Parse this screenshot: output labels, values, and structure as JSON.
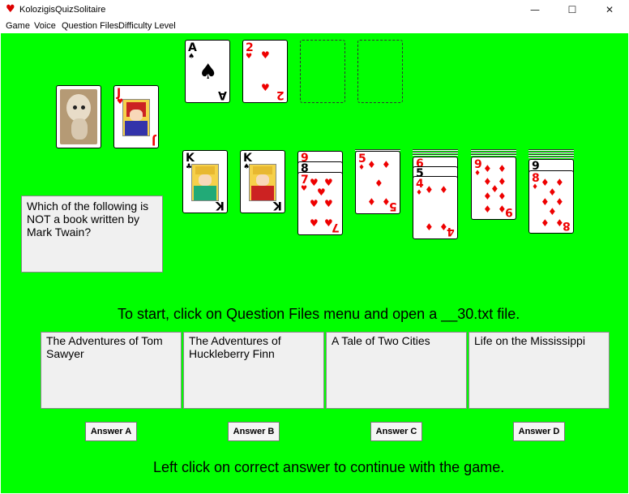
{
  "window": {
    "title": "KolozigisQuizSolitaire",
    "app_icon": "♥",
    "minimize": "—",
    "maximize": "☐",
    "close": "✕"
  },
  "menu": [
    "Game",
    "Voice",
    "Question Files",
    "Difficulty Level"
  ],
  "colors": {
    "table": "#00ff00",
    "red_suit": "#e00000"
  },
  "stock": {
    "top_card": "J♥",
    "rank": "J",
    "suit": "♥"
  },
  "foundations": [
    {
      "rank": "A",
      "suit": "♠"
    },
    {
      "rank": "2",
      "suit": "♥"
    }
  ],
  "tableau": [
    {
      "rank": "K",
      "suit": "♣"
    },
    {
      "rank": "K",
      "suit": "♠"
    },
    {
      "rank": "7",
      "suit": "♥",
      "under": [
        {
          "rank": "9",
          "suit": "♥"
        },
        {
          "rank": "8",
          "suit": "♠"
        }
      ]
    },
    {
      "rank": "5",
      "suit": "♦"
    },
    {
      "rank": "4",
      "suit": "♦",
      "under": [
        {
          "rank": "6",
          "suit": "♥"
        },
        {
          "rank": "5",
          "suit": "♠"
        }
      ]
    },
    {
      "rank": "9",
      "suit": "♦"
    },
    {
      "rank": "8",
      "suit": "♦",
      "under": [
        {
          "rank": "9",
          "suit": "♣"
        }
      ]
    }
  ],
  "question": "Which of the following is NOT a book written by Mark Twain?",
  "instruction_top": "To start, click on Question Files menu and open a __30.txt file.",
  "answers": [
    {
      "text": "The Adventures of Tom Sawyer",
      "button": "Answer A"
    },
    {
      "text": "The Adventures of Huckleberry Finn",
      "button": "Answer B"
    },
    {
      "text": "A Tale of Two Cities",
      "button": "Answer C"
    },
    {
      "text": "Life on the Mississippi",
      "button": "Answer D"
    }
  ],
  "instruction_bottom": "Left click on correct answer to continue with the game."
}
